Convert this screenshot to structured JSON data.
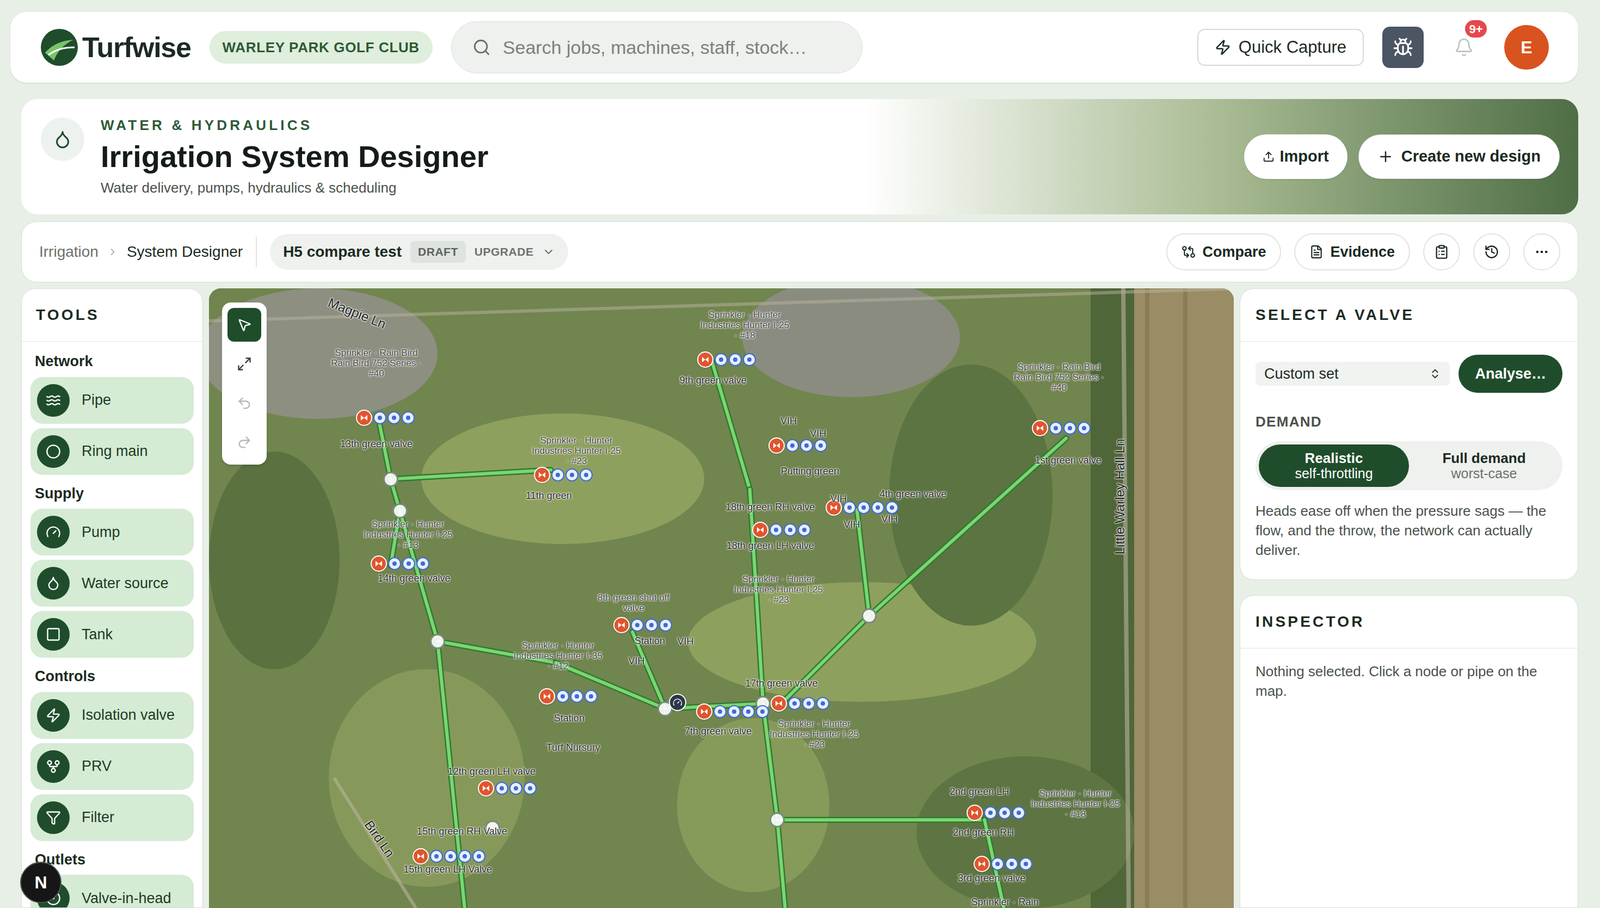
{
  "header": {
    "logo": "Turfwise",
    "club": "WARLEY PARK GOLF CLUB",
    "search_placeholder": "Search jobs, machines, staff, stock…",
    "quick_capture": "Quick Capture",
    "notifications_badge": "9+",
    "avatar": "E"
  },
  "page": {
    "section": "WATER & HYDRAULICS",
    "title": "Irrigation System Designer",
    "subtitle": "Water delivery, pumps, hydraulics & scheduling",
    "import": "Import",
    "create": "Create new design"
  },
  "toolbar": {
    "breadcrumb": [
      "Irrigation",
      "System Designer"
    ],
    "design": {
      "name": "H5 compare test",
      "status": "DRAFT",
      "mode": "UPGRADE"
    },
    "actions": [
      "Compare",
      "Evidence"
    ]
  },
  "tools": {
    "title": "TOOLS",
    "groups": [
      {
        "label": "Network",
        "items": [
          "Pipe",
          "Ring main"
        ]
      },
      {
        "label": "Supply",
        "items": [
          "Pump",
          "Water source",
          "Tank"
        ]
      },
      {
        "label": "Controls",
        "items": [
          "Isolation valve",
          "PRV",
          "Filter"
        ]
      },
      {
        "label": "Outlets",
        "items": [
          "Valve-in-head"
        ]
      }
    ]
  },
  "map": {
    "tools": [
      {
        "selected": true,
        "disabled": false
      },
      {
        "selected": false,
        "disabled": false
      },
      {
        "selected": false,
        "disabled": true
      },
      {
        "selected": false,
        "disabled": true
      }
    ],
    "labels": [
      {
        "text": "Magpie Ln",
        "kind": "road"
      },
      {
        "text": "Sprinkler · Rain Bird Rain Bird 752 Series · #40",
        "kind": "sprinkler"
      },
      {
        "text": "13th green valve",
        "kind": "valve"
      },
      {
        "text": "Sprinkler · Hunter Industries Hunter I-25 · #23",
        "kind": "sprinkler"
      },
      {
        "text": "11th green",
        "kind": "valve"
      },
      {
        "text": "Sprinkler · Hunter Industries Hunter I-25 · #13",
        "kind": "sprinkler"
      },
      {
        "text": "14th green valve",
        "kind": "valve"
      },
      {
        "text": "Sprinkler · Hunter Industries Hunter I-25 · #18",
        "kind": "sprinkler"
      },
      {
        "text": "9th green valve",
        "kind": "valve"
      },
      {
        "text": "VIH",
        "kind": "valve"
      },
      {
        "text": "VIH",
        "kind": "valve"
      },
      {
        "text": "Putting green",
        "kind": "valve"
      },
      {
        "text": "VIH",
        "kind": "valve"
      },
      {
        "text": "4th green valve",
        "kind": "valve"
      },
      {
        "text": "VIH",
        "kind": "valve"
      },
      {
        "text": "VIH",
        "kind": "valve"
      },
      {
        "text": "18th green RH valve",
        "kind": "valve"
      },
      {
        "text": "18th green LH valve",
        "kind": "valve"
      },
      {
        "text": "Sprinkler · Hunter Industries Hunter I-25 · #23",
        "kind": "sprinkler"
      },
      {
        "text": "Sprinkler · Rain Bird Rain Bird 752 Series · #40",
        "kind": "sprinkler"
      },
      {
        "text": "1st green valve",
        "kind": "valve"
      },
      {
        "text": "Little Warley Hall Ln",
        "kind": "road"
      },
      {
        "text": "8th green shut off valve",
        "kind": "sprinkler"
      },
      {
        "text": "Station",
        "kind": "valve"
      },
      {
        "text": "VIH",
        "kind": "valve"
      },
      {
        "text": "VIH",
        "kind": "valve"
      },
      {
        "text": "Sprinkler · Hunter Industries Hunter I-35 · #12",
        "kind": "sprinkler"
      },
      {
        "text": "Station",
        "kind": "valve"
      },
      {
        "text": "Turf Nursury",
        "kind": "valve"
      },
      {
        "text": "17th green valve",
        "kind": "valve"
      },
      {
        "text": "7th green valve",
        "kind": "valve"
      },
      {
        "text": "Sprinkler · Hunter Industries Hunter I-25 · #23",
        "kind": "sprinkler"
      },
      {
        "text": "12th green LH valve",
        "kind": "valve"
      },
      {
        "text": "15th green RH Valve",
        "kind": "valve"
      },
      {
        "text": "15th green LH Valve",
        "kind": "valve"
      },
      {
        "text": "Bird Ln",
        "kind": "road"
      },
      {
        "text": "2nd green LH",
        "kind": "valve"
      },
      {
        "text": "Sprinkler · Hunter Industries Hunter I-25 · #18",
        "kind": "sprinkler"
      },
      {
        "text": "2nd green RH",
        "kind": "valve"
      },
      {
        "text": "3rd green valve",
        "kind": "valve"
      },
      {
        "text": "Sprinkler · Rain",
        "kind": "valve"
      }
    ]
  },
  "floating_button": "N",
  "valve_panel": {
    "title": "SELECT A VALVE",
    "set": "Custom set",
    "analyse": "Analyse…",
    "demand_label": "DEMAND",
    "demand_options": [
      {
        "line1": "Realistic",
        "line2": "self-throttling",
        "selected": true
      },
      {
        "line1": "Full demand",
        "line2": "worst-case",
        "selected": false
      }
    ],
    "description": "Heads ease off when the pressure sags — the flow, and the throw, the network can actually deliver."
  },
  "inspector": {
    "title": "INSPECTOR",
    "empty": "Nothing selected. Click a node or pipe on the map."
  }
}
